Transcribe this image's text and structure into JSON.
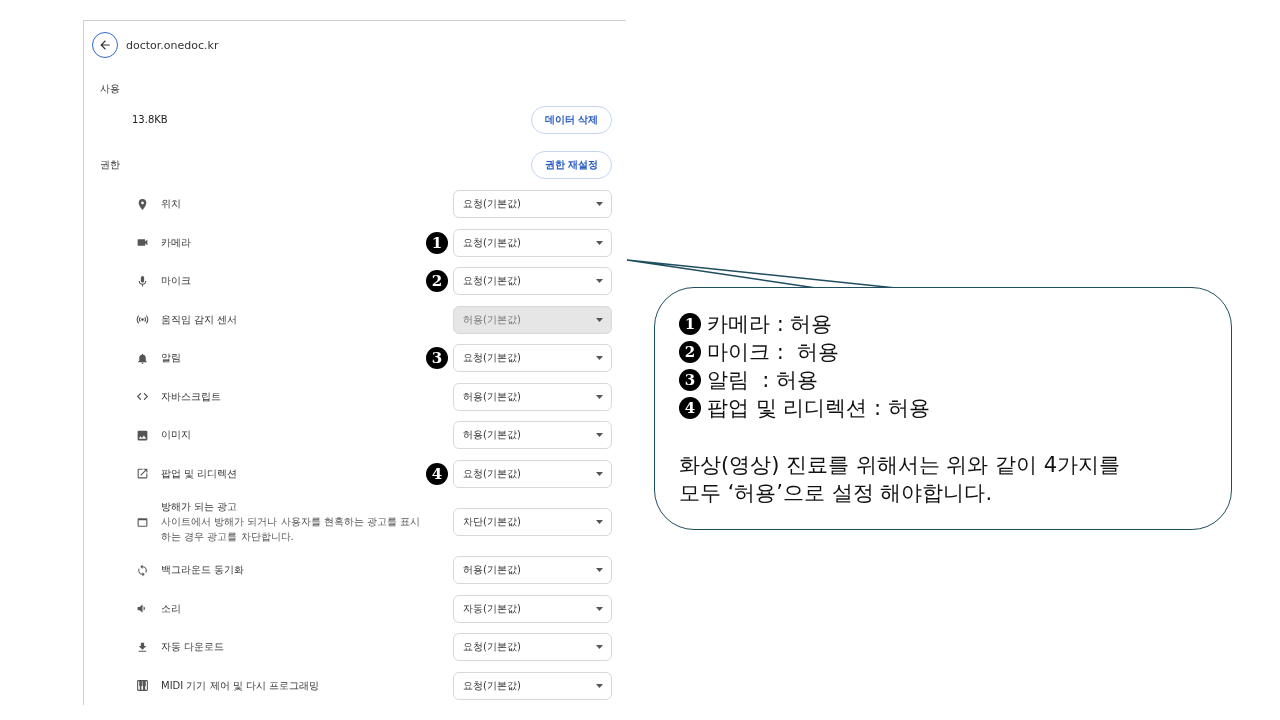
{
  "site": {
    "title": "doctor.onedoc.kr"
  },
  "usage": {
    "heading": "사용",
    "size": "13.8KB",
    "button": "데이터 삭제"
  },
  "permissions": {
    "heading": "권한",
    "button": "권한 재설정",
    "rows": [
      {
        "label": "위치",
        "value": "요청(기본값)",
        "disabled": false
      },
      {
        "label": "카메라",
        "value": "요청(기본값)",
        "disabled": false,
        "marker": "1"
      },
      {
        "label": "마이크",
        "value": "요청(기본값)",
        "disabled": false,
        "marker": "2"
      },
      {
        "label": "움직임 감지 센서",
        "value": "허용(기본값)",
        "disabled": true
      },
      {
        "label": "알림",
        "value": "요청(기본값)",
        "disabled": false,
        "marker": "3"
      },
      {
        "label": "자바스크립트",
        "value": "허용(기본값)",
        "disabled": false
      },
      {
        "label": "이미지",
        "value": "허용(기본값)",
        "disabled": false
      },
      {
        "label": "팝업 및 리디렉션",
        "value": "요청(기본값)",
        "disabled": false,
        "marker": "4"
      },
      {
        "label": "방해가 되는 광고",
        "description": "사이트에서 방해가 되거나 사용자를 현혹하는 광고를 표시하는 경우 광고를 차단합니다.",
        "value": "차단(기본값)",
        "disabled": false
      },
      {
        "label": "백그라운드 동기화",
        "value": "허용(기본값)",
        "disabled": false
      },
      {
        "label": "소리",
        "value": "자동(기본값)",
        "disabled": false
      },
      {
        "label": "자동 다운로드",
        "value": "요청(기본값)",
        "disabled": false
      },
      {
        "label": "MIDI 기기 제어 및 다시 프로그래밍",
        "value": "요청(기본값)",
        "disabled": false
      }
    ]
  },
  "callout": {
    "items": [
      {
        "marker": "1",
        "text": "카메라 : 허용"
      },
      {
        "marker": "2",
        "text": "마이크 :  허용"
      },
      {
        "marker": "3",
        "text": "알림  : 허용"
      },
      {
        "marker": "4",
        "text": "팝업 및 리디렉션 : 허용"
      }
    ],
    "note": "화상(영상) 진료를 위해서는 위와 같이 4가지를 모두 ‘허용’으로 설정 해야합니다."
  }
}
